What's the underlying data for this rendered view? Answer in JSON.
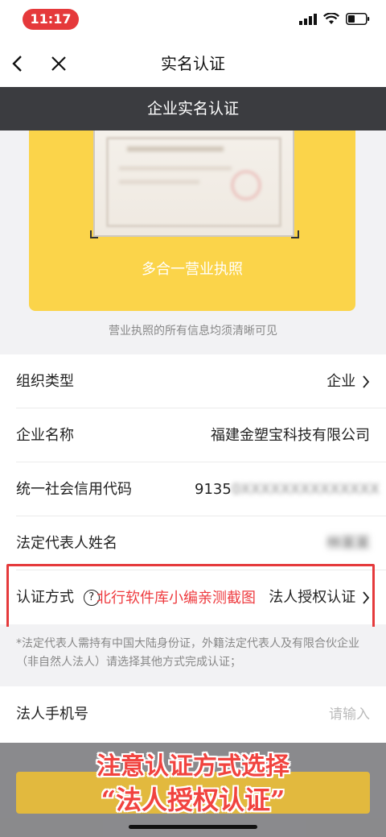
{
  "status_bar": {
    "time": "11:17"
  },
  "nav": {
    "title": "实名认证"
  },
  "header": {
    "title": "企业实名认证"
  },
  "license": {
    "label": "多合一营业执照",
    "hint": "营业执照的所有信息均须清晰可见"
  },
  "form": {
    "rows": [
      {
        "label": "组织类型",
        "value": "企业"
      },
      {
        "label": "企业名称",
        "value": "福建金塑宝科技有限公司"
      },
      {
        "label": "统一社会信用代码",
        "value_prefix": "9135",
        "value_blurred": "0XXXXXXXXXXXXXX"
      },
      {
        "label": "法定代表人姓名",
        "value_blurred": "林某某"
      },
      {
        "label": "认证方式",
        "value": "法人授权认证"
      }
    ],
    "note": "*法定代表人需持有中国大陆身份证，外籍法定代表人及有限合伙企业（非自然人法人）请选择其他方式完成认证；",
    "phone": {
      "label": "法人手机号",
      "placeholder": "请输入"
    }
  },
  "watermark": "北行软件库小编亲测截图",
  "caption": {
    "line1": "注意认证方式选择",
    "line2": "“法人授权认证”"
  },
  "colors": {
    "accent_yellow": "#fbd44a",
    "dark_header": "#3b3c40",
    "highlight_red": "#e53a3c"
  }
}
